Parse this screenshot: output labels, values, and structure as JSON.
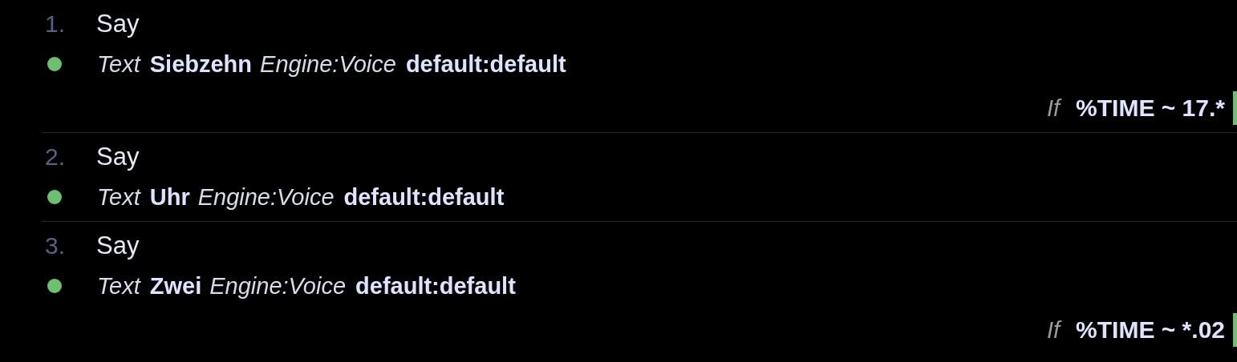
{
  "actions": [
    {
      "number": "1.",
      "name": "Say",
      "enabled": true,
      "params": [
        {
          "label": "Text",
          "value": "Siebzehn"
        },
        {
          "label": "Engine:Voice",
          "value": "default:default"
        }
      ],
      "condition": {
        "keyword": "If",
        "expression": "%TIME ~ 17.*"
      }
    },
    {
      "number": "2.",
      "name": "Say",
      "enabled": true,
      "params": [
        {
          "label": "Text",
          "value": "Uhr"
        },
        {
          "label": "Engine:Voice",
          "value": "default:default"
        }
      ]
    },
    {
      "number": "3.",
      "name": "Say",
      "enabled": true,
      "params": [
        {
          "label": "Text",
          "value": "Zwei"
        },
        {
          "label": "Engine:Voice",
          "value": "default:default"
        }
      ],
      "condition": {
        "keyword": "If",
        "expression": "%TIME ~ *.02"
      }
    }
  ]
}
